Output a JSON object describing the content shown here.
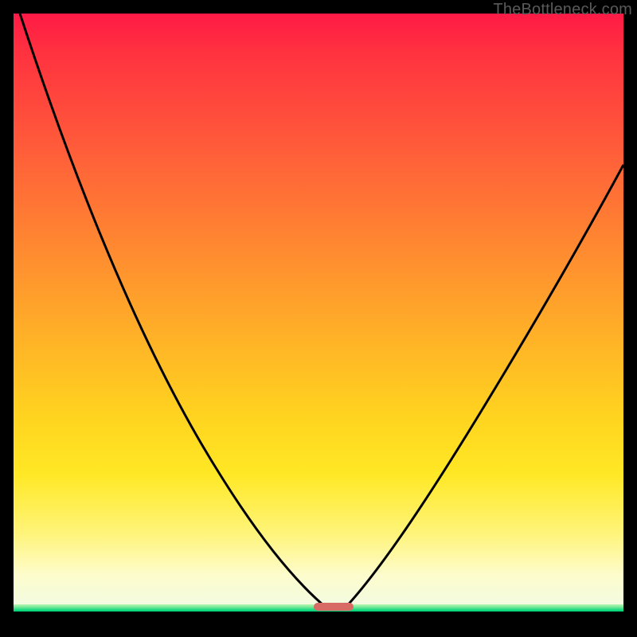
{
  "watermark": "TheBottleneck.com",
  "chart_data": {
    "type": "line",
    "title": "",
    "xlabel": "",
    "ylabel": "",
    "xlim": [
      0,
      100
    ],
    "ylim": [
      0,
      100
    ],
    "grid": false,
    "legend": false,
    "series": [
      {
        "name": "left-curve",
        "x": [
          0,
          5,
          10,
          15,
          20,
          25,
          30,
          35,
          40,
          45,
          49,
          51,
          53
        ],
        "y": [
          100,
          92,
          83,
          74,
          65,
          55,
          45,
          35,
          25,
          15,
          6,
          2,
          0
        ]
      },
      {
        "name": "right-curve",
        "x": [
          53,
          55,
          58,
          62,
          67,
          73,
          80,
          88,
          95,
          100
        ],
        "y": [
          0,
          2,
          6,
          13,
          22,
          33,
          45,
          58,
          69,
          76
        ]
      }
    ],
    "marker": {
      "name": "bottleneck-marker",
      "color": "#d86a66",
      "x_range": [
        50,
        56
      ],
      "y": 0
    },
    "background_gradient": {
      "top": "#ff1a46",
      "mid_upper": "#ff8a30",
      "mid": "#ffe825",
      "lower": "#fdfccc",
      "band": "#00d478"
    }
  }
}
